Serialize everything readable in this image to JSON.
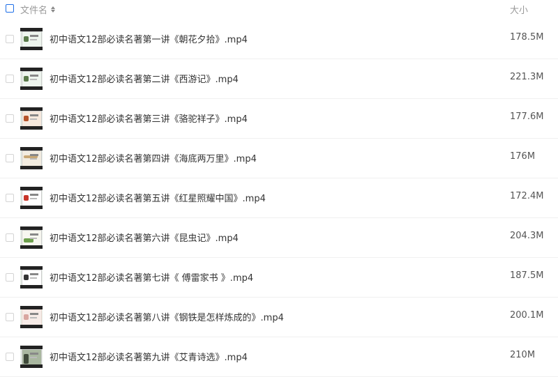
{
  "header": {
    "name_label": "文件名",
    "size_label": "大小"
  },
  "files": [
    {
      "name": "初中语文12部必读名著第一讲《朝花夕拾》.mp4",
      "size": "178.5M",
      "thumb": "film-thumbnail"
    },
    {
      "name": "初中语文12部必读名著第二讲《西游记》.mp4",
      "size": "221.3M",
      "thumb": "film-thumbnail"
    },
    {
      "name": "初中语文12部必读名著第三讲《骆驼祥子》.mp4",
      "size": "177.6M",
      "thumb": "film-thumbnail"
    },
    {
      "name": "初中语文12部必读名著第四讲《海底两万里》.mp4",
      "size": "176M",
      "thumb": "film-thumbnail"
    },
    {
      "name": "初中语文12部必读名著第五讲《红星照耀中国》.mp4",
      "size": "172.4M",
      "thumb": "film-thumbnail"
    },
    {
      "name": "初中语文12部必读名著第六讲《昆虫记》.mp4",
      "size": "204.3M",
      "thumb": "film-thumbnail"
    },
    {
      "name": "初中语文12部必读名著第七讲《 傅雷家书 》.mp4",
      "size": "187.5M",
      "thumb": "film-thumbnail"
    },
    {
      "name": "初中语文12部必读名著第八讲《钢铁是怎样炼成的》.mp4",
      "size": "200.1M",
      "thumb": "film-thumbnail"
    },
    {
      "name": "初中语文12部必读名著第九讲《艾青诗选》.mp4",
      "size": "210M",
      "thumb": "film-thumbnail"
    }
  ],
  "colors": {
    "accent": "#1e6fe8",
    "header_text": "#999999",
    "row_border": "#f0f0f0"
  }
}
